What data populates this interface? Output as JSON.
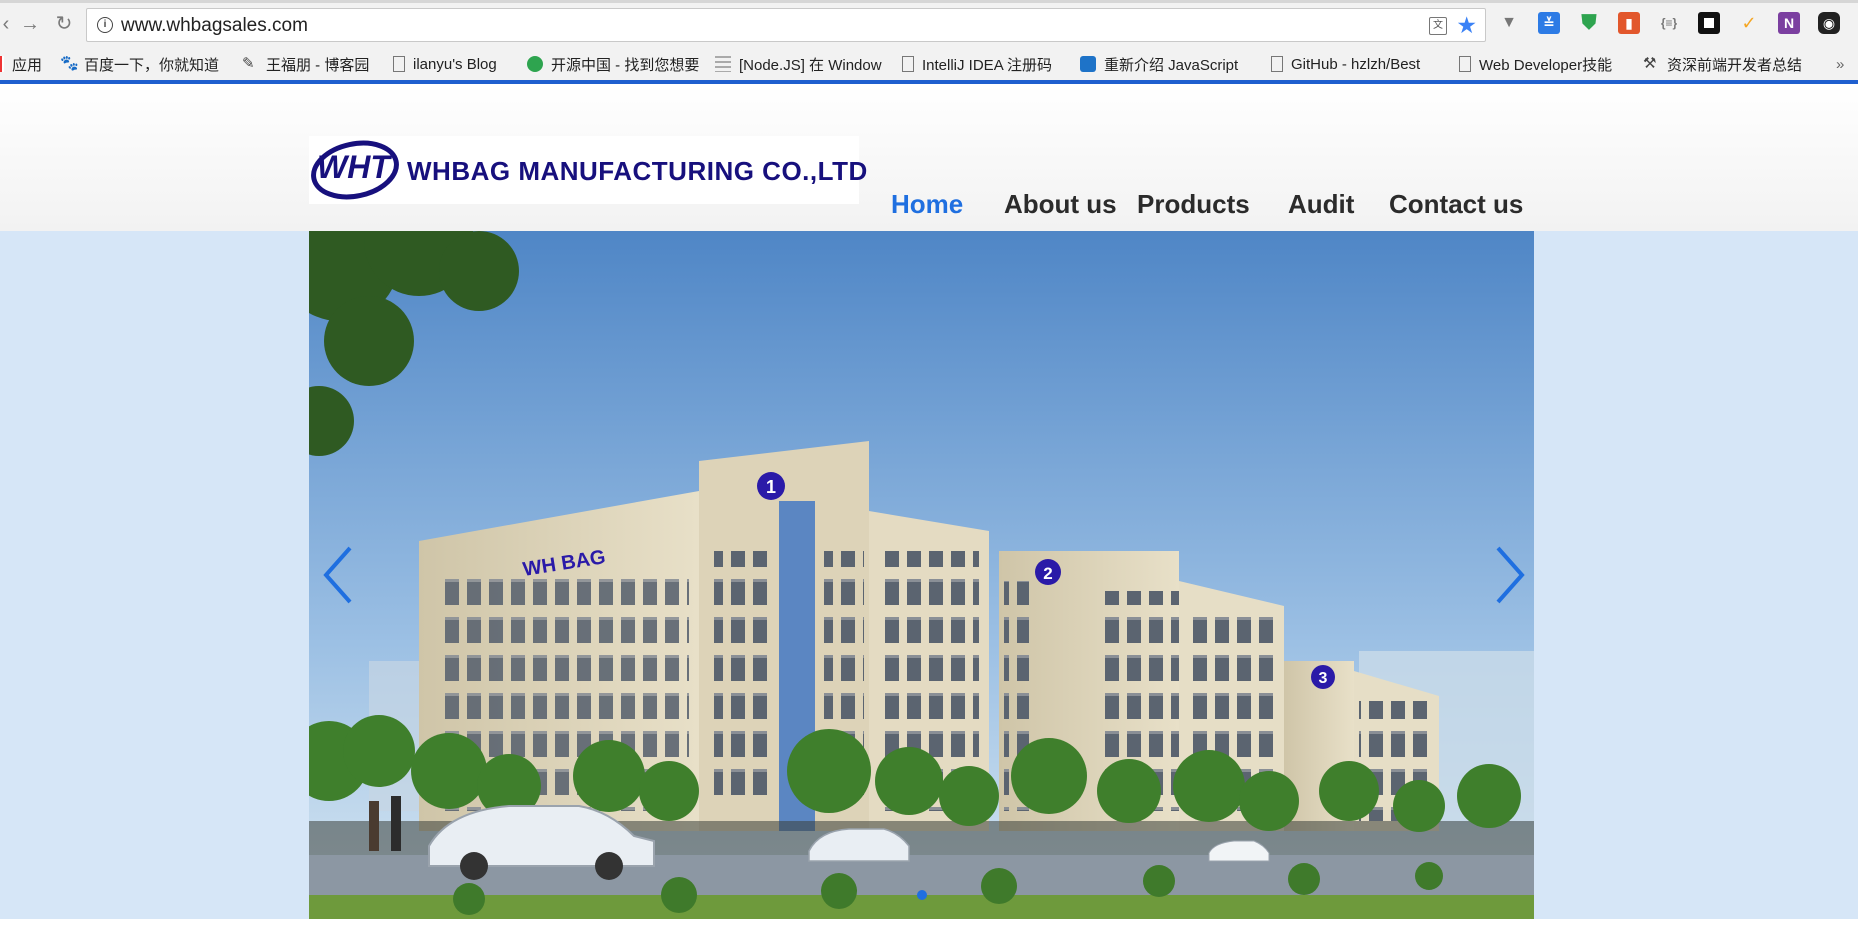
{
  "browser": {
    "url": "www.whbagsales.com",
    "bookmarks": [
      {
        "label": "应用",
        "icon": "apps-icon"
      },
      {
        "label": "百度一下，你就知道",
        "icon": "baidu-icon"
      },
      {
        "label": "王福朋 - 博客园",
        "icon": "cnblogs-icon"
      },
      {
        "label": "ilanyu's Blog",
        "icon": "page-icon"
      },
      {
        "label": "开源中国 - 找到您想要",
        "icon": "oschina-icon"
      },
      {
        "label": "[Node.JS] 在 Window",
        "icon": "grid-icon"
      },
      {
        "label": "IntelliJ IDEA 注册码",
        "icon": "page-icon"
      },
      {
        "label": "重新介绍 JavaScript",
        "icon": "mdn-icon"
      },
      {
        "label": "GitHub - hzlzh/Best",
        "icon": "page-icon"
      },
      {
        "label": "Web Developer技能",
        "icon": "page-icon"
      },
      {
        "label": "资深前端开发者总结",
        "icon": "hammer-icon"
      }
    ]
  },
  "site": {
    "logo_text": "WHBAG MANUFACTURING CO.,LTD",
    "logo_mark": "WHT",
    "nav": [
      {
        "label": "Home",
        "active": true
      },
      {
        "label": "About us",
        "active": false
      },
      {
        "label": "Products",
        "active": false
      },
      {
        "label": "Audit",
        "active": false
      },
      {
        "label": "Contact us",
        "active": false
      }
    ],
    "accent_color": "#1f6fe0",
    "brand_color": "#17107d"
  },
  "banner": {
    "building_sign": "WH BAG",
    "building_numbers": [
      "1",
      "2",
      "3"
    ],
    "active_slide": 1
  }
}
